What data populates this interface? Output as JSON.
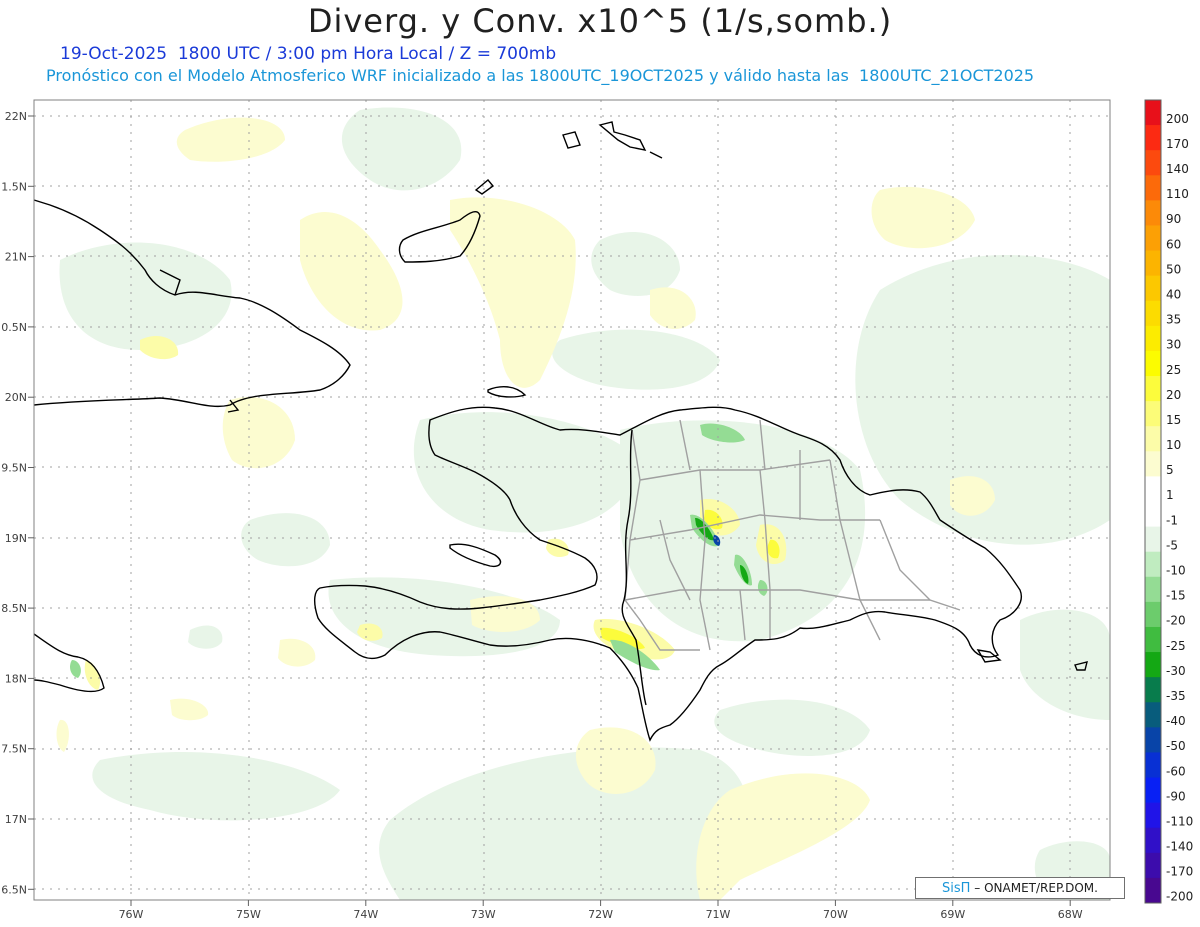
{
  "header": {
    "title": "Diverg. y Conv. x10^5 (1/s,somb.)",
    "subtitle_time": "19-Oct-2025  1800 UTC / 3:00 pm Hora Local / Z = 700mb",
    "subtitle_model": "Pronóstico con el Modelo Atmosferico WRF inicializado a las 1800UTC_19OCT2025 y válido hasta las  1800UTC_21OCT2025"
  },
  "map": {
    "lat_labels": [
      "22N",
      "1.5N",
      "21N",
      "0.5N",
      "20N",
      "9.5N",
      "19N",
      "8.5N",
      "18N",
      "7.5N",
      "17N",
      "6.5N"
    ],
    "lon_labels": [
      "76W",
      "75W",
      "74W",
      "73W",
      "72W",
      "71W",
      "70W",
      "69W",
      "68W"
    ],
    "lat_range": [
      16.5,
      22.0
    ],
    "lon_range": [
      -76.8,
      -67.6
    ]
  },
  "colorbar": {
    "labels": [
      "200",
      "170",
      "140",
      "110",
      "90",
      "60",
      "50",
      "40",
      "35",
      "30",
      "25",
      "20",
      "15",
      "10",
      "5",
      "1",
      "-1",
      "-5",
      "-10",
      "-15",
      "-20",
      "-25",
      "-30",
      "-35",
      "-40",
      "-50",
      "-60",
      "-90",
      "-110",
      "-140",
      "-170",
      "-200"
    ],
    "colors": [
      "#e8101a",
      "#fc2a12",
      "#fc4a0e",
      "#fc6a0a",
      "#fc8a08",
      "#fca005",
      "#fcb400",
      "#fcc800",
      "#fcdc00",
      "#fcec00",
      "#fcfc00",
      "#fcfc3c",
      "#fcfc78",
      "#fcfca8",
      "#fcfcd0",
      "#ffffff",
      "#ffffff",
      "#e8f5e8",
      "#c0ecc0",
      "#94dc94",
      "#6ccc6c",
      "#40bc40",
      "#14a814",
      "#087c4c",
      "#085c7c",
      "#0844a8",
      "#0830d4",
      "#0820f4",
      "#2014e8",
      "#3010c8",
      "#3c0cac",
      "#480890"
    ]
  },
  "credit": {
    "brand": "SisΠ",
    "org": "– ONAMET/REP.DOM."
  }
}
